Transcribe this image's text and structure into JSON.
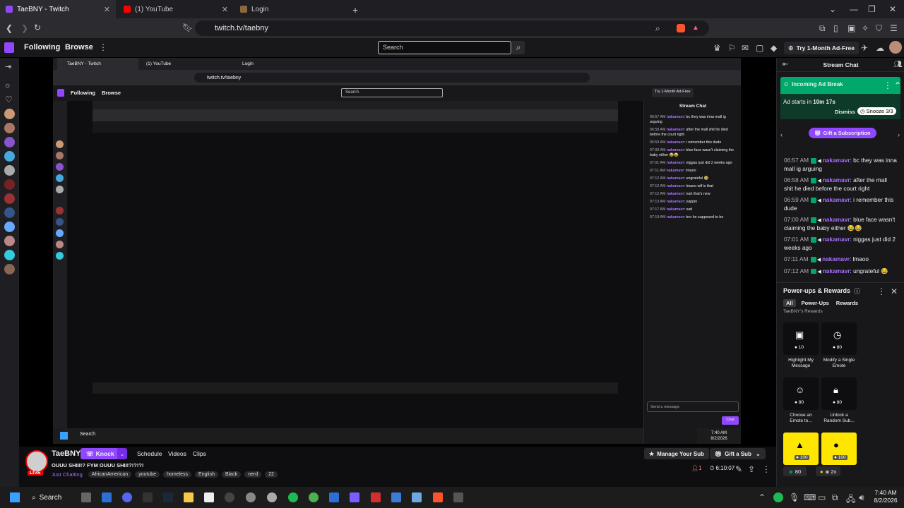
{
  "browser": {
    "tabs": [
      {
        "label": "TaeBNY - Twitch",
        "active": true
      },
      {
        "label": "(1) YouTube",
        "active": false
      },
      {
        "label": "Login",
        "active": false
      }
    ],
    "url": "twitch.tv/taebny"
  },
  "topnav": {
    "following": "Following",
    "browse": "Browse",
    "search_placeholder": "Search",
    "ad_free": "Try 1-Month Ad-Free"
  },
  "inner": {
    "tabs": [
      "TaeBNY - Twitch",
      "(1) YouTube",
      "Login"
    ],
    "url": "twitch.tv/taebny",
    "following": "Following",
    "browse": "Browse",
    "search": "Search",
    "ad_free": "Try 1-Month Ad-Free",
    "stream_chat": "Stream Chat",
    "chat_lines": [
      {
        "ts": "06:57 AM",
        "nm": "nakamavr",
        "txt": "bc they was inna mall ig arguing"
      },
      {
        "ts": "06:58 AM",
        "nm": "nakamavr",
        "txt": "after the mall shit he died before the court right"
      },
      {
        "ts": "06:59 AM",
        "nm": "nakamavr",
        "txt": "i remember this dude"
      },
      {
        "ts": "07:00 AM",
        "nm": "nakamavr",
        "txt": "blue face wasn't claiming the baby either 😂😂"
      },
      {
        "ts": "07:01 AM",
        "nm": "nakamavr",
        "txt": "niggas just did 2 weeks ago"
      },
      {
        "ts": "07:11 AM",
        "nm": "nakamavr",
        "txt": "lmaoo"
      },
      {
        "ts": "07:12 AM",
        "nm": "nakamavr",
        "txt": "ungrateful 😂"
      },
      {
        "ts": "07:12 AM",
        "nm": "nakamavr",
        "txt": "lmaoo wtf is that"
      },
      {
        "ts": "07:12 AM",
        "nm": "nakamavr",
        "txt": "nah that's new"
      },
      {
        "ts": "07:13 AM",
        "nm": "nakamavr",
        "txt": "yappin"
      },
      {
        "ts": "07:17 AM",
        "nm": "nakamavr",
        "txt": "sad"
      },
      {
        "ts": "07:19 AM",
        "nm": "nakamavr",
        "txt": "bro he supposed to be"
      }
    ],
    "send_placeholder": "Send a message",
    "chat_btn": "Chat",
    "search_taskbar": "Search",
    "time": "7:40 AM",
    "date": "8/2/2026"
  },
  "channel": {
    "name": "TaeBNY",
    "knock": "Knock",
    "nav": [
      "Schedule",
      "Videos",
      "Clips"
    ],
    "title": "OUUU SHIII!? FYM OUUU SHII!?!?!?!",
    "live": "LIVE",
    "category": "Just Chatting",
    "tags": [
      "AfricanAmerican",
      "youtube",
      "homeless",
      "English",
      "Black",
      "nerd",
      "22"
    ],
    "manage_sub": "Manage Your Sub",
    "gift_sub": "Gift a Sub",
    "viewers": "1",
    "uptime": "6:10:07"
  },
  "chat": {
    "header": "Stream Chat",
    "ad_title": "Incoming Ad Break",
    "ad_text_prefix": "Ad starts in ",
    "ad_time": "10m 17s",
    "dismiss": "Dismiss",
    "snooze": "Snooze 3/3",
    "gift": "Gift a Subscription",
    "messages": [
      {
        "ts": "06:57 AM",
        "nm": "nakamavr",
        "txt": "bc they was inna mall ig arguing"
      },
      {
        "ts": "06:58 AM",
        "nm": "nakamavr",
        "txt": "after the mall shit he died before the court right"
      },
      {
        "ts": "06:59 AM",
        "nm": "nakamavr",
        "txt": "i remember this dude"
      },
      {
        "ts": "07:00 AM",
        "nm": "nakamavr",
        "txt": "blue face wasn't claiming the baby either 😂😂"
      },
      {
        "ts": "07:01 AM",
        "nm": "nakamavr",
        "txt": "niggas just did 2 weeks ago"
      },
      {
        "ts": "07:11 AM",
        "nm": "nakamavr",
        "txt": "lmaoo"
      },
      {
        "ts": "07:12 AM",
        "nm": "nakamavr",
        "txt": "ungrateful 😂"
      },
      {
        "ts": "07:12 AM",
        "nm": "nakamavr",
        "txt": "lmaoo wtf is that"
      }
    ],
    "powerups_title": "Power-ups & Rewards",
    "filter_tabs": [
      "All",
      "Power-Ups",
      "Rewards"
    ],
    "rewards_caption": "TaeBNY's Rewards",
    "rewards": [
      {
        "label": "Highlight My Message",
        "cost": "10"
      },
      {
        "label": "Modify a Single Emote",
        "cost": "80"
      },
      {
        "label": "Choose an Emote to...",
        "cost": "80"
      },
      {
        "label": "Unlock a Random Sub...",
        "cost": "80"
      },
      {
        "label": "",
        "cost": "100"
      },
      {
        "label": "",
        "cost": "100"
      }
    ],
    "points": "80",
    "multiplier": "2x"
  },
  "taskbar": {
    "search": "Search",
    "time": "7:40 AM",
    "date": "8/2/2026"
  },
  "colors": {
    "twitch_purple": "#9147ff",
    "live_red": "#eb0400",
    "ad_green": "#00a86b"
  }
}
